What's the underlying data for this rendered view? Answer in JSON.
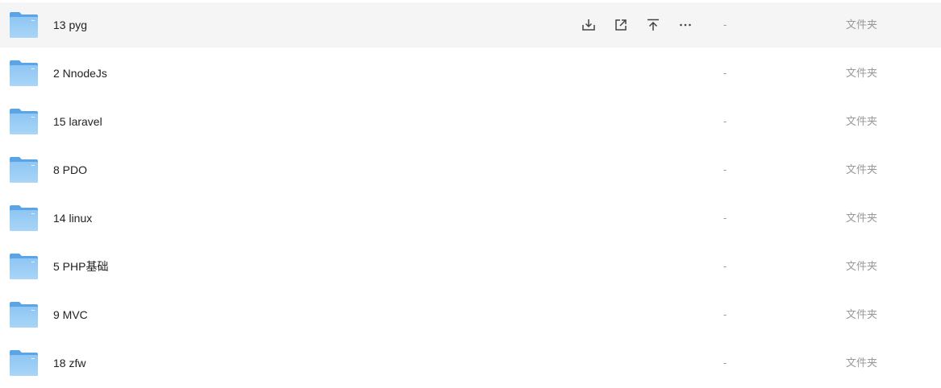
{
  "colors": {
    "hover_background": "#f5f5f5",
    "folder_blue": "#7ab8ee",
    "meta_text": "#999999"
  },
  "row_actions": {
    "download_icon": "download-icon",
    "share_icon": "share-icon",
    "pin_top_icon": "pin-top-icon",
    "more_icon": "more-icon"
  },
  "files": [
    {
      "name": "13 pyg",
      "size": "-",
      "type": "文件夹"
    },
    {
      "name": "2 NnodeJs",
      "size": "-",
      "type": "文件夹"
    },
    {
      "name": "15 laravel",
      "size": "-",
      "type": "文件夹"
    },
    {
      "name": "8 PDO",
      "size": "-",
      "type": "文件夹"
    },
    {
      "name": "14 linux",
      "size": "-",
      "type": "文件夹"
    },
    {
      "name": "5 PHP基础",
      "size": "-",
      "type": "文件夹"
    },
    {
      "name": "9 MVC",
      "size": "-",
      "type": "文件夹"
    },
    {
      "name": "18 zfw",
      "size": "-",
      "type": "文件夹"
    }
  ]
}
